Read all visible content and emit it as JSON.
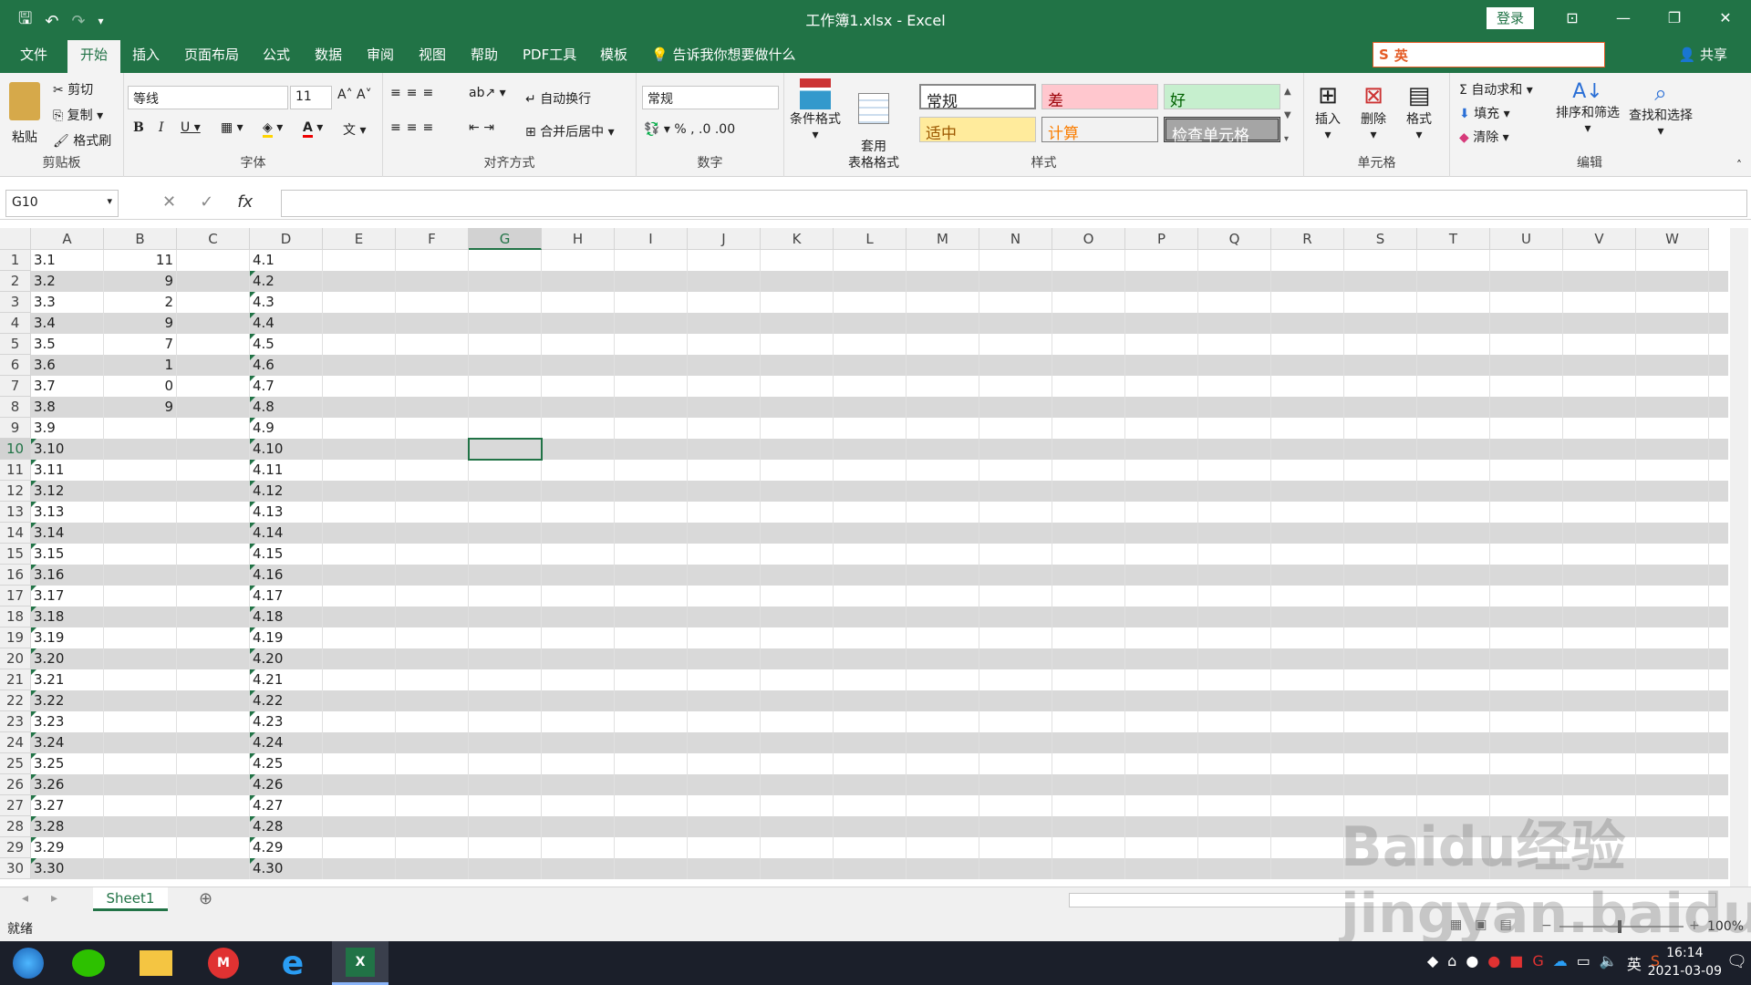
{
  "window": {
    "title": "工作簿1.xlsx  -  Excel",
    "login": "登录"
  },
  "tabs": [
    "文件",
    "开始",
    "插入",
    "页面布局",
    "公式",
    "数据",
    "审阅",
    "视图",
    "帮助",
    "PDF工具",
    "模板"
  ],
  "active_tab": "开始",
  "tell_me": "告诉我你想要做什么",
  "share": "共享",
  "ribbon": {
    "clipboard": {
      "paste": "粘贴",
      "cut": "剪切",
      "copy": "复制",
      "format_painter": "格式刷",
      "label": "剪贴板"
    },
    "font": {
      "name": "等线",
      "size": "11",
      "label": "字体"
    },
    "alignment": {
      "wrap": "自动换行",
      "merge": "合并后居中",
      "label": "对齐方式"
    },
    "number": {
      "format": "常规",
      "label": "数字"
    },
    "styles": {
      "cond_format": "条件格式",
      "table_format": "套用\n表格格式",
      "normal": "常规",
      "bad": "差",
      "good": "好",
      "neutral": "适中",
      "calc": "计算",
      "check": "检查单元格",
      "label": "样式"
    },
    "cells": {
      "insert": "插入",
      "delete": "删除",
      "format": "格式",
      "label": "单元格"
    },
    "editing": {
      "autosum": "自动求和",
      "fill": "填充",
      "clear": "清除",
      "sort": "排序和筛选",
      "find": "查找和选择",
      "label": "编辑"
    }
  },
  "namebox": "G10",
  "columns": [
    "A",
    "B",
    "C",
    "D",
    "E",
    "F",
    "G",
    "H",
    "I",
    "J",
    "K",
    "L",
    "M",
    "N",
    "O",
    "P",
    "Q",
    "R",
    "S",
    "T",
    "U",
    "V",
    "W"
  ],
  "selected_col": "G",
  "selected_row": 10,
  "rows": [
    {
      "n": "1",
      "a": "3.1",
      "b": "11",
      "d": "4.1"
    },
    {
      "n": "2",
      "a": "3.2",
      "b": "9",
      "d": "4.2"
    },
    {
      "n": "3",
      "a": "3.3",
      "b": "2",
      "d": "4.3"
    },
    {
      "n": "4",
      "a": "3.4",
      "b": "9",
      "d": "4.4"
    },
    {
      "n": "5",
      "a": "3.5",
      "b": "7",
      "d": "4.5"
    },
    {
      "n": "6",
      "a": "3.6",
      "b": "1",
      "d": "4.6"
    },
    {
      "n": "7",
      "a": "3.7",
      "b": "0",
      "d": "4.7"
    },
    {
      "n": "8",
      "a": "3.8",
      "b": "9",
      "d": "4.8"
    },
    {
      "n": "9",
      "a": "3.9",
      "b": "",
      "d": "4.9"
    },
    {
      "n": "10",
      "a": "3.10",
      "b": "",
      "d": "4.10"
    },
    {
      "n": "11",
      "a": "3.11",
      "b": "",
      "d": "4.11"
    },
    {
      "n": "12",
      "a": "3.12",
      "b": "",
      "d": "4.12"
    },
    {
      "n": "13",
      "a": "3.13",
      "b": "",
      "d": "4.13"
    },
    {
      "n": "14",
      "a": "3.14",
      "b": "",
      "d": "4.14"
    },
    {
      "n": "15",
      "a": "3.15",
      "b": "",
      "d": "4.15"
    },
    {
      "n": "16",
      "a": "3.16",
      "b": "",
      "d": "4.16"
    },
    {
      "n": "17",
      "a": "3.17",
      "b": "",
      "d": "4.17"
    },
    {
      "n": "18",
      "a": "3.18",
      "b": "",
      "d": "4.18"
    },
    {
      "n": "19",
      "a": "3.19",
      "b": "",
      "d": "4.19"
    },
    {
      "n": "20",
      "a": "3.20",
      "b": "",
      "d": "4.20"
    },
    {
      "n": "21",
      "a": "3.21",
      "b": "",
      "d": "4.21"
    },
    {
      "n": "22",
      "a": "3.22",
      "b": "",
      "d": "4.22"
    },
    {
      "n": "23",
      "a": "3.23",
      "b": "",
      "d": "4.23"
    },
    {
      "n": "24",
      "a": "3.24",
      "b": "",
      "d": "4.24"
    },
    {
      "n": "25",
      "a": "3.25",
      "b": "",
      "d": "4.25"
    },
    {
      "n": "26",
      "a": "3.26",
      "b": "",
      "d": "4.26"
    },
    {
      "n": "27",
      "a": "3.27",
      "b": "",
      "d": "4.27"
    },
    {
      "n": "28",
      "a": "3.28",
      "b": "",
      "d": "4.28"
    },
    {
      "n": "29",
      "a": "3.29",
      "b": "",
      "d": "4.29"
    },
    {
      "n": "30",
      "a": "3.30",
      "b": "",
      "d": "4.30"
    }
  ],
  "sheet_tab": "Sheet1",
  "status": {
    "ready": "就绪",
    "zoom": "100%"
  },
  "clock": {
    "time": "16:14",
    "date": "2021-03-09"
  },
  "ime": "英",
  "watermark": "Baidu经验 jingyan.baidu.com"
}
